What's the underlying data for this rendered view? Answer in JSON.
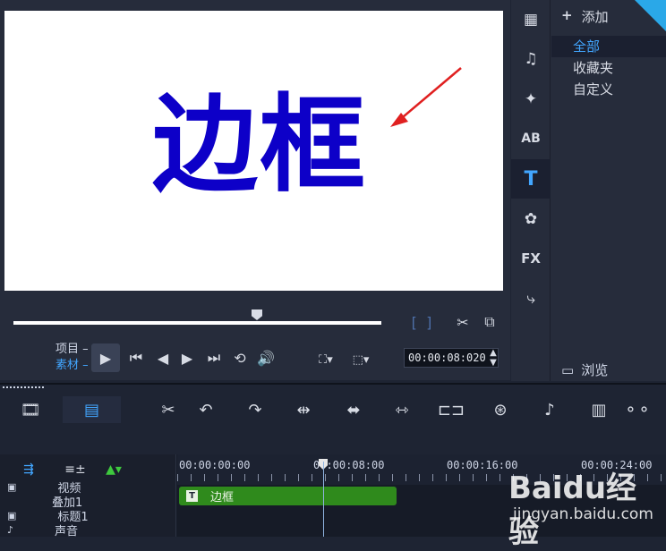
{
  "preview": {
    "title_text": "边框",
    "project_label": "项目",
    "clip_label": "素材",
    "timecode": "00:00:08:020"
  },
  "library": {
    "add_label": "添加",
    "items": [
      "全部",
      "收藏夹",
      "自定义"
    ],
    "browse_label": "浏览"
  },
  "categories": [
    "media-icon",
    "audio-icon",
    "transition-icon",
    "ab-icon",
    "title-icon",
    "graphic-icon",
    "fx-icon",
    "path-icon"
  ],
  "timeline": {
    "ticks": [
      "00:00:00:00",
      "00:00:08:00",
      "00:00:16:00",
      "00:00:24:00"
    ],
    "clip_label": "边框",
    "tracks": [
      "视频",
      "叠加1",
      "标题1",
      "声音"
    ]
  },
  "watermark": {
    "brand": "Baidu经验",
    "url": "jingyan.baidu.com"
  },
  "colors": {
    "accent": "#42a6ff",
    "title_blue": "#0d00c8",
    "clip_green": "#2f8a1c"
  }
}
